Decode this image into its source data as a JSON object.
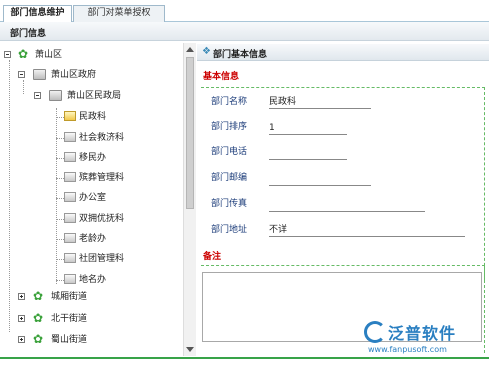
{
  "tabs": [
    {
      "label": "部门信息维护",
      "active": true
    },
    {
      "label": "部门对菜单授权",
      "active": false
    }
  ],
  "page_title": "部门信息",
  "tree": {
    "root": "萧山区",
    "gov": "萧山区政府",
    "civil": "萧山区民政局",
    "items": [
      "民政科",
      "社会救济科",
      "移民办",
      "殡葬管理科",
      "办公室",
      "双拥优抚科",
      "老龄办",
      "社团管理科",
      "地名办"
    ],
    "streets": [
      "城厢街道",
      "北干街道",
      "蜀山街道"
    ]
  },
  "section_title": "部门基本信息",
  "basic_title": "基本信息",
  "fields": [
    {
      "label": "部门名称",
      "value": "民政科"
    },
    {
      "label": "部门排序",
      "value": "1"
    },
    {
      "label": "部门电话",
      "value": ""
    },
    {
      "label": "部门邮编",
      "value": ""
    },
    {
      "label": "部门传真",
      "value": ""
    },
    {
      "label": "部门地址",
      "value": "不详"
    }
  ],
  "remark_title": "备注",
  "remark_value": "",
  "watermark": {
    "name": "泛普软件",
    "url": "www.fanpusoft.com"
  },
  "colors": {
    "accent": "#38a348",
    "label": "#1d3d7a",
    "heading_red": "#cc0000"
  }
}
